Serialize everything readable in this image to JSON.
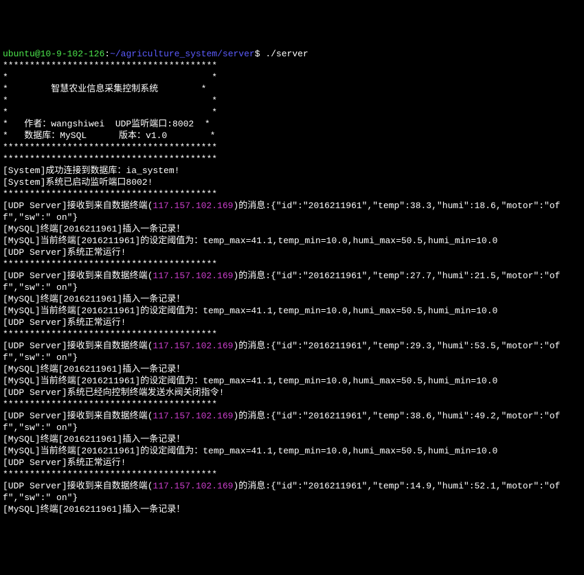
{
  "prompt": {
    "user": "ubuntu",
    "host": "10-9-102-126",
    "path": "~/agriculture_system/server",
    "cmd": "./server"
  },
  "banner": {
    "row_border": "****************************************",
    "row_empty": "*                                      *",
    "title": "*        智慧农业信息采集控制系统        *",
    "author": "*   作者：wangshiwei  UDP监听端口:8002  *",
    "db": "*   数据库：MySQL      版本：v1.0        *"
  },
  "hr": "****************************************",
  "sys": {
    "db_connect": "[System]成功连接到数据库：ia_system!",
    "listen": "[System]系统已启动监听端口8002!"
  },
  "ip": "117.157.102.169",
  "msg_prefix": "[UDP Server]接收到来自数据终端(",
  "msg_suffix": ")的消息:",
  "insert_prefix": "[MySQL]终端[",
  "insert_suffix": "]插入一条记录！",
  "threshold_prefix": "[MySQL]当前终端[",
  "threshold_mid": "]的设定阈值为：",
  "device_id": "2016211961",
  "threshold_values": "temp_max=41.1,temp_min=10.0,humi_max=50.5,humi_min=10.0",
  "block": [
    {
      "json": "{\"id\":\"2016211961\",\"temp\":38.3,\"humi\":18.6,\"motor\":\"off\",\"sw\":\" on\"}",
      "post": "[UDP Server]系统正常运行!"
    },
    {
      "json": "{\"id\":\"2016211961\",\"temp\":27.7,\"humi\":21.5,\"motor\":\"off\",\"sw\":\" on\"}",
      "post": "[UDP Server]系统正常运行!"
    },
    {
      "json": "{\"id\":\"2016211961\",\"temp\":29.3,\"humi\":53.5,\"motor\":\"off\",\"sw\":\" on\"}",
      "post": "[UDP Server]系统已经向控制终端发送水阀关闭指令!"
    },
    {
      "json": "{\"id\":\"2016211961\",\"temp\":38.6,\"humi\":49.2,\"motor\":\"off\",\"sw\":\" on\"}",
      "post": "[UDP Server]系统正常运行!"
    },
    {
      "json": "{\"id\":\"2016211961\",\"temp\":14.9,\"humi\":52.1,\"motor\":\"off\",\"sw\":\" on\"}",
      "post": ""
    }
  ]
}
